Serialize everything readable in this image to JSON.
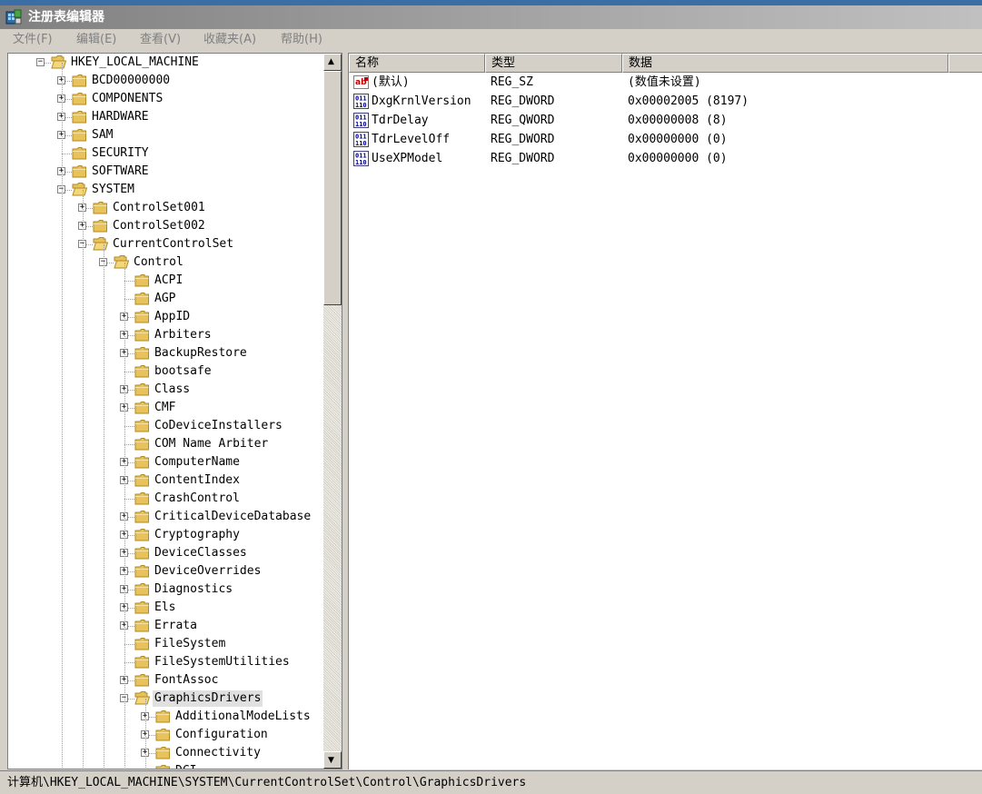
{
  "window": {
    "title": "注册表编辑器"
  },
  "menu": [
    {
      "label": "文件(F)"
    },
    {
      "label": "编辑(E)"
    },
    {
      "label": "查看(V)"
    },
    {
      "label": "收藏夹(A)"
    },
    {
      "label": "帮助(H)"
    }
  ],
  "tree": {
    "nodes": [
      {
        "label": "HKEY_LOCAL_MACHINE",
        "level": 0,
        "toggle": "minus"
      },
      {
        "label": "BCD00000000",
        "level": 1,
        "toggle": "plus"
      },
      {
        "label": "COMPONENTS",
        "level": 1,
        "toggle": "plus"
      },
      {
        "label": "HARDWARE",
        "level": 1,
        "toggle": "plus"
      },
      {
        "label": "SAM",
        "level": 1,
        "toggle": "plus"
      },
      {
        "label": "SECURITY",
        "level": 1,
        "toggle": "none"
      },
      {
        "label": "SOFTWARE",
        "level": 1,
        "toggle": "plus"
      },
      {
        "label": "SYSTEM",
        "level": 1,
        "toggle": "minus"
      },
      {
        "label": "ControlSet001",
        "level": 2,
        "toggle": "plus"
      },
      {
        "label": "ControlSet002",
        "level": 2,
        "toggle": "plus"
      },
      {
        "label": "CurrentControlSet",
        "level": 2,
        "toggle": "minus"
      },
      {
        "label": "Control",
        "level": 3,
        "toggle": "minus"
      },
      {
        "label": "ACPI",
        "level": 4,
        "toggle": "none"
      },
      {
        "label": "AGP",
        "level": 4,
        "toggle": "none"
      },
      {
        "label": "AppID",
        "level": 4,
        "toggle": "plus"
      },
      {
        "label": "Arbiters",
        "level": 4,
        "toggle": "plus"
      },
      {
        "label": "BackupRestore",
        "level": 4,
        "toggle": "plus"
      },
      {
        "label": "bootsafe",
        "level": 4,
        "toggle": "none"
      },
      {
        "label": "Class",
        "level": 4,
        "toggle": "plus"
      },
      {
        "label": "CMF",
        "level": 4,
        "toggle": "plus"
      },
      {
        "label": "CoDeviceInstallers",
        "level": 4,
        "toggle": "none"
      },
      {
        "label": "COM Name Arbiter",
        "level": 4,
        "toggle": "none"
      },
      {
        "label": "ComputerName",
        "level": 4,
        "toggle": "plus"
      },
      {
        "label": "ContentIndex",
        "level": 4,
        "toggle": "plus"
      },
      {
        "label": "CrashControl",
        "level": 4,
        "toggle": "none"
      },
      {
        "label": "CriticalDeviceDatabase",
        "level": 4,
        "toggle": "plus"
      },
      {
        "label": "Cryptography",
        "level": 4,
        "toggle": "plus"
      },
      {
        "label": "DeviceClasses",
        "level": 4,
        "toggle": "plus"
      },
      {
        "label": "DeviceOverrides",
        "level": 4,
        "toggle": "plus"
      },
      {
        "label": "Diagnostics",
        "level": 4,
        "toggle": "plus"
      },
      {
        "label": "Els",
        "level": 4,
        "toggle": "plus"
      },
      {
        "label": "Errata",
        "level": 4,
        "toggle": "plus"
      },
      {
        "label": "FileSystem",
        "level": 4,
        "toggle": "none"
      },
      {
        "label": "FileSystemUtilities",
        "level": 4,
        "toggle": "none"
      },
      {
        "label": "FontAssoc",
        "level": 4,
        "toggle": "plus"
      },
      {
        "label": "GraphicsDrivers",
        "level": 4,
        "toggle": "minus",
        "selected": true
      },
      {
        "label": "AdditionalModeLists",
        "level": 5,
        "toggle": "plus"
      },
      {
        "label": "Configuration",
        "level": 5,
        "toggle": "plus"
      },
      {
        "label": "Connectivity",
        "level": 5,
        "toggle": "plus"
      },
      {
        "label": "DCI",
        "level": 5,
        "toggle": "none"
      }
    ]
  },
  "list": {
    "columns": {
      "name": "名称",
      "type": "类型",
      "data": "数据"
    },
    "rows": [
      {
        "icon": "string-value-icon",
        "name": "(默认)",
        "type": "REG_SZ",
        "data": "(数值未设置)"
      },
      {
        "icon": "binary-value-icon",
        "name": "DxgKrnlVersion",
        "type": "REG_DWORD",
        "data": "0x00002005 (8197)"
      },
      {
        "icon": "binary-value-icon",
        "name": "TdrDelay",
        "type": "REG_QWORD",
        "data": "0x00000008 (8)"
      },
      {
        "icon": "binary-value-icon",
        "name": "TdrLevelOff",
        "type": "REG_DWORD",
        "data": "0x00000000 (0)"
      },
      {
        "icon": "binary-value-icon",
        "name": "UseXPModel",
        "type": "REG_DWORD",
        "data": "0x00000000 (0)"
      }
    ]
  },
  "statusbar": {
    "path": "计算机\\HKEY_LOCAL_MACHINE\\SYSTEM\\CurrentControlSet\\Control\\GraphicsDrivers"
  }
}
